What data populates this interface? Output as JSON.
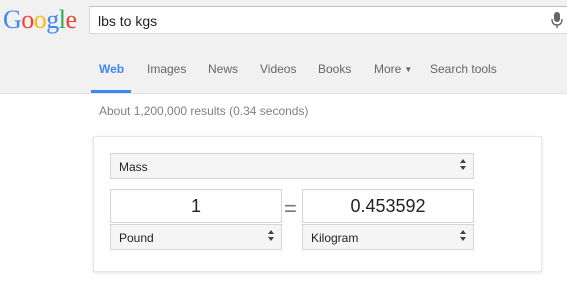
{
  "logo": {
    "text": "Google",
    "letters": [
      "G",
      "o",
      "o",
      "g",
      "l",
      "e"
    ],
    "colors": [
      "#4285f4",
      "#ea4335",
      "#fbbc05",
      "#4285f4",
      "#34a853",
      "#ea4335"
    ]
  },
  "search": {
    "query": "lbs to kgs"
  },
  "tabs": [
    {
      "label": "Web",
      "active": true
    },
    {
      "label": "Images",
      "active": false
    },
    {
      "label": "News",
      "active": false
    },
    {
      "label": "Videos",
      "active": false
    },
    {
      "label": "Books",
      "active": false
    },
    {
      "label": "More",
      "active": false
    },
    {
      "label": "Search tools",
      "active": false
    }
  ],
  "results": {
    "stats": "About 1,200,000 results (0.34 seconds)"
  },
  "converter": {
    "quantity": "Mass",
    "from_value": "1",
    "to_value": "0.453592",
    "equals": "=",
    "from_unit": "Pound",
    "to_unit": "Kilogram"
  },
  "colors": {
    "accent": "#4285f4",
    "topbar": "#f1f1f1"
  }
}
